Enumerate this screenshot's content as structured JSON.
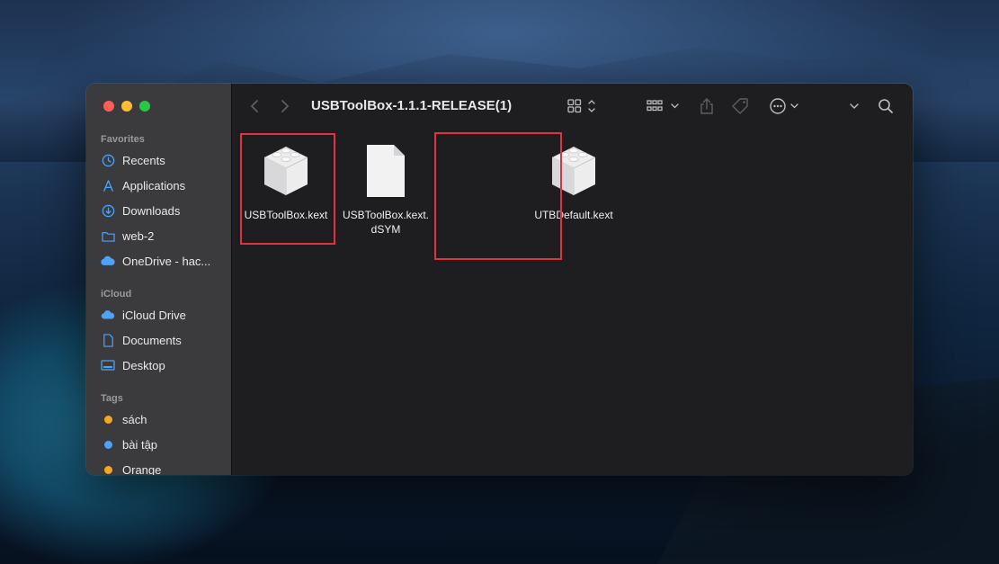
{
  "window": {
    "title": "USBToolBox-1.1.1-RELEASE(1)"
  },
  "sidebar": {
    "favorites_title": "Favorites",
    "favorites": [
      {
        "label": "Recents",
        "icon": "clock-icon"
      },
      {
        "label": "Applications",
        "icon": "applications-icon"
      },
      {
        "label": "Downloads",
        "icon": "downloads-icon"
      },
      {
        "label": "web-2",
        "icon": "folder-icon"
      },
      {
        "label": "OneDrive - hac...",
        "icon": "cloud-icon"
      }
    ],
    "icloud_title": "iCloud",
    "icloud": [
      {
        "label": "iCloud Drive",
        "icon": "icloud-icon"
      },
      {
        "label": "Documents",
        "icon": "document-icon"
      },
      {
        "label": "Desktop",
        "icon": "desktop-icon"
      }
    ],
    "tags_title": "Tags",
    "tags": [
      {
        "label": "sách",
        "color": "#f5a623"
      },
      {
        "label": "bài tập",
        "color": "#4fa3f7"
      },
      {
        "label": "Orange",
        "color": "#f5a623"
      }
    ]
  },
  "files": [
    {
      "name": "USBToolBox.kext",
      "icon": "kext-bundle-icon",
      "highlighted": true
    },
    {
      "name": "USBToolBox.kext.\ndSYM",
      "icon": "generic-document-icon",
      "highlighted": false
    },
    {
      "name": "UTBDefault.kext",
      "icon": "kext-bundle-icon",
      "highlighted": true
    }
  ],
  "colors": {
    "highlight": "#e23241",
    "sidebar_bg": "#3b3b3e",
    "content_bg": "#1e1e20"
  }
}
